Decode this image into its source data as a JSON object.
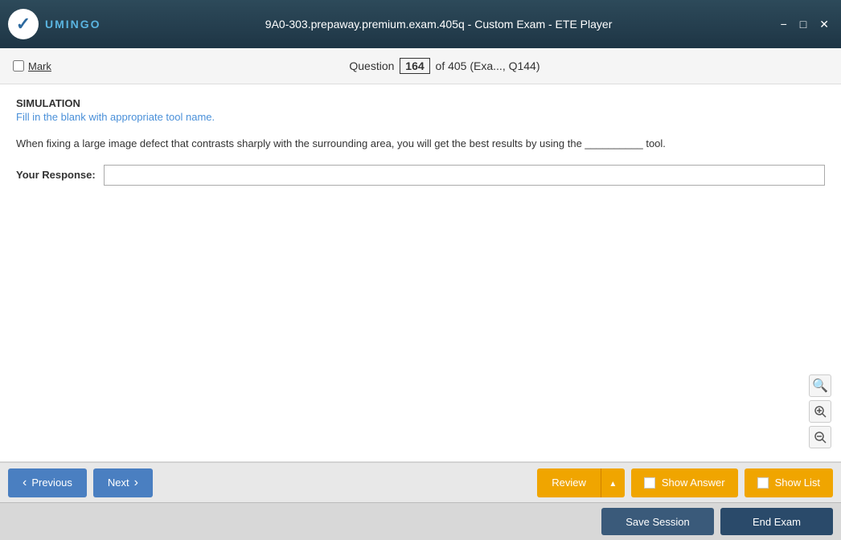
{
  "titlebar": {
    "title": "9A0-303.prepaway.premium.exam.405q - Custom Exam - ETE Player",
    "logo_text": "UMINGO",
    "minimize": "−",
    "restore": "□",
    "close": "✕"
  },
  "header": {
    "mark_label": "Mark",
    "question_prefix": "Question",
    "question_number": "164",
    "question_total": "of 405 (Exa..., Q144)"
  },
  "content": {
    "type_label": "SIMULATION",
    "instruction": "Fill in the blank with appropriate tool name.",
    "question_text": "When fixing a large image defect that contrasts sharply with the surrounding area, you will get the best results by using the __________ tool.",
    "response_label": "Your Response:",
    "response_placeholder": "",
    "response_value": ""
  },
  "toolbar": {
    "previous_label": "Previous",
    "next_label": "Next",
    "review_label": "Review",
    "show_answer_label": "Show Answer",
    "show_list_label": "Show List"
  },
  "actions": {
    "save_session_label": "Save Session",
    "end_exam_label": "End Exam"
  },
  "zoom": {
    "search_icon": "🔍",
    "zoom_in_icon": "+",
    "zoom_out_icon": "−"
  }
}
